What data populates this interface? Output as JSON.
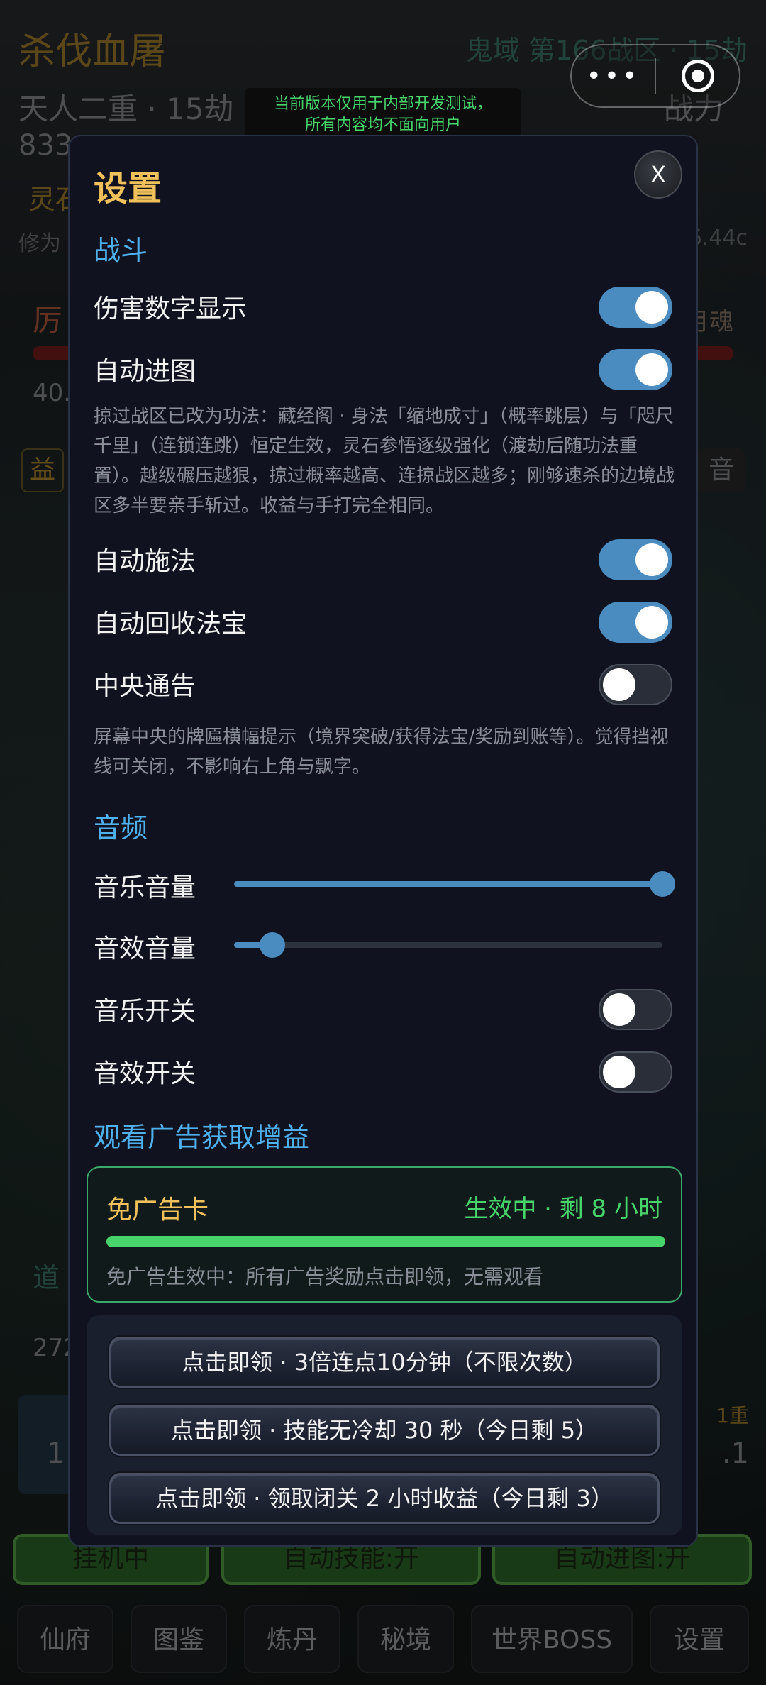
{
  "background": {
    "title": "杀伐血屠",
    "zone": "鬼域 第166战区 · 15劫",
    "status_line": "天人二重 · 15劫",
    "status_line_right": "战力",
    "number_partial": "833",
    "tag": "灵石",
    "cultivation_label": "修为",
    "rate": "6.44c",
    "red_label": "厉",
    "soul_label": "月魂",
    "value_40": "40.",
    "yi": "益",
    "yin": "音",
    "dao": "道",
    "value_272": "272",
    "level_1": "1重",
    "value_1": "1",
    "value_d1": ".1",
    "hp_bar_level": 1.0,
    "colors": {
      "title_gold": "#a8822e",
      "zone_teal": "#3f7a6c"
    }
  },
  "dev_notice": {
    "line1": "当前版本仅用于内部开发测试，",
    "line2": "所有内容均不面向用户"
  },
  "bottom_buttons": [
    "挂机中",
    "自动技能:开",
    "自动进图:开"
  ],
  "nav": [
    "仙府",
    "图鉴",
    "炼丹",
    "秘境",
    "世界BOSS",
    "设置"
  ],
  "capsule": {
    "more_icon": "more-dots-icon",
    "target_icon": "record-target-icon"
  },
  "modal": {
    "title": "设置",
    "close": "X",
    "battle": {
      "title": "战斗",
      "damage_numbers": {
        "label": "伤害数字显示",
        "on": true
      },
      "auto_enter": {
        "label": "自动进图",
        "on": true
      },
      "auto_enter_desc": "掠过战区已改为功法：藏经阁 · 身法「缩地成寸」（概率跳层）与「咫尺千里」（连锁连跳）恒定生效，灵石参悟逐级强化（渡劫后随功法重置）。越级碾压越狠，掠过概率越高、连掠战区越多；刚够速杀的边境战区多半要亲手斩过。收益与手打完全相同。",
      "auto_cast": {
        "label": "自动施法",
        "on": true
      },
      "auto_recycle": {
        "label": "自动回收法宝",
        "on": true
      },
      "center_notice": {
        "label": "中央通告",
        "on": false
      },
      "center_notice_desc": "屏幕中央的牌匾横幅提示（境界突破/获得法宝/奖励到账等）。觉得挡视线可关闭，不影响右上角与飘字。"
    },
    "audio": {
      "title": "音频",
      "music_volume": {
        "label": "音乐音量",
        "value": 1.0
      },
      "sfx_volume": {
        "label": "音效音量",
        "value": 0.09
      },
      "music_switch": {
        "label": "音乐开关",
        "on": false
      },
      "sfx_switch": {
        "label": "音效开关",
        "on": false
      }
    },
    "ads": {
      "title": "观看广告获取增益",
      "card": {
        "name": "免广告卡",
        "status": "生效中 · 剩 8 小时",
        "progress": 1.0,
        "hint": "免广告生效中：所有广告奖励点击即领，无需观看"
      },
      "claims": [
        "点击即领 · 3倍连点10分钟（不限次数）",
        "点击即领 · 技能无冷却 30 秒（今日剩 5）",
        "点击即领 · 领取闭关 2 小时收益（今日剩 3）"
      ]
    }
  }
}
